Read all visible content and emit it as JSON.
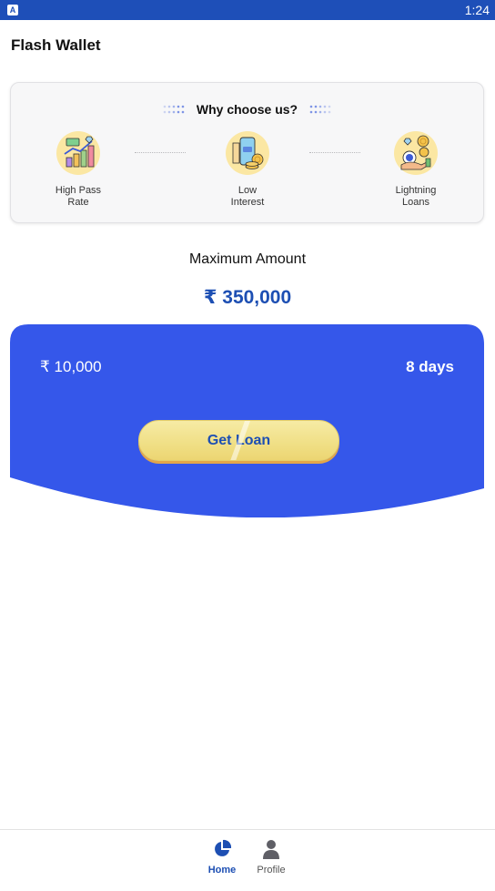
{
  "status_bar": {
    "time": "1:24"
  },
  "app": {
    "title": "Flash Wallet"
  },
  "why": {
    "title": "Why choose us?",
    "features": [
      {
        "line1": "High Pass",
        "line2": "Rate",
        "icon": "chart-growth-icon"
      },
      {
        "line1": "Low",
        "line2": "Interest",
        "icon": "phone-coins-icon"
      },
      {
        "line1": "Lightning",
        "line2": "Loans",
        "icon": "hand-coins-icon"
      }
    ]
  },
  "loan": {
    "max_label": "Maximum Amount",
    "max_amount": "₹ 350,000",
    "min_amount": "₹ 10,000",
    "term": "8 days",
    "button_label": "Get Loan"
  },
  "nav": {
    "home_label": "Home",
    "profile_label": "Profile"
  },
  "colors": {
    "status_bar": "#1e4fb8",
    "panel_blue": "#3557ea",
    "accent_blue": "#1d4fb3",
    "button_yellow": "#f0df85"
  }
}
